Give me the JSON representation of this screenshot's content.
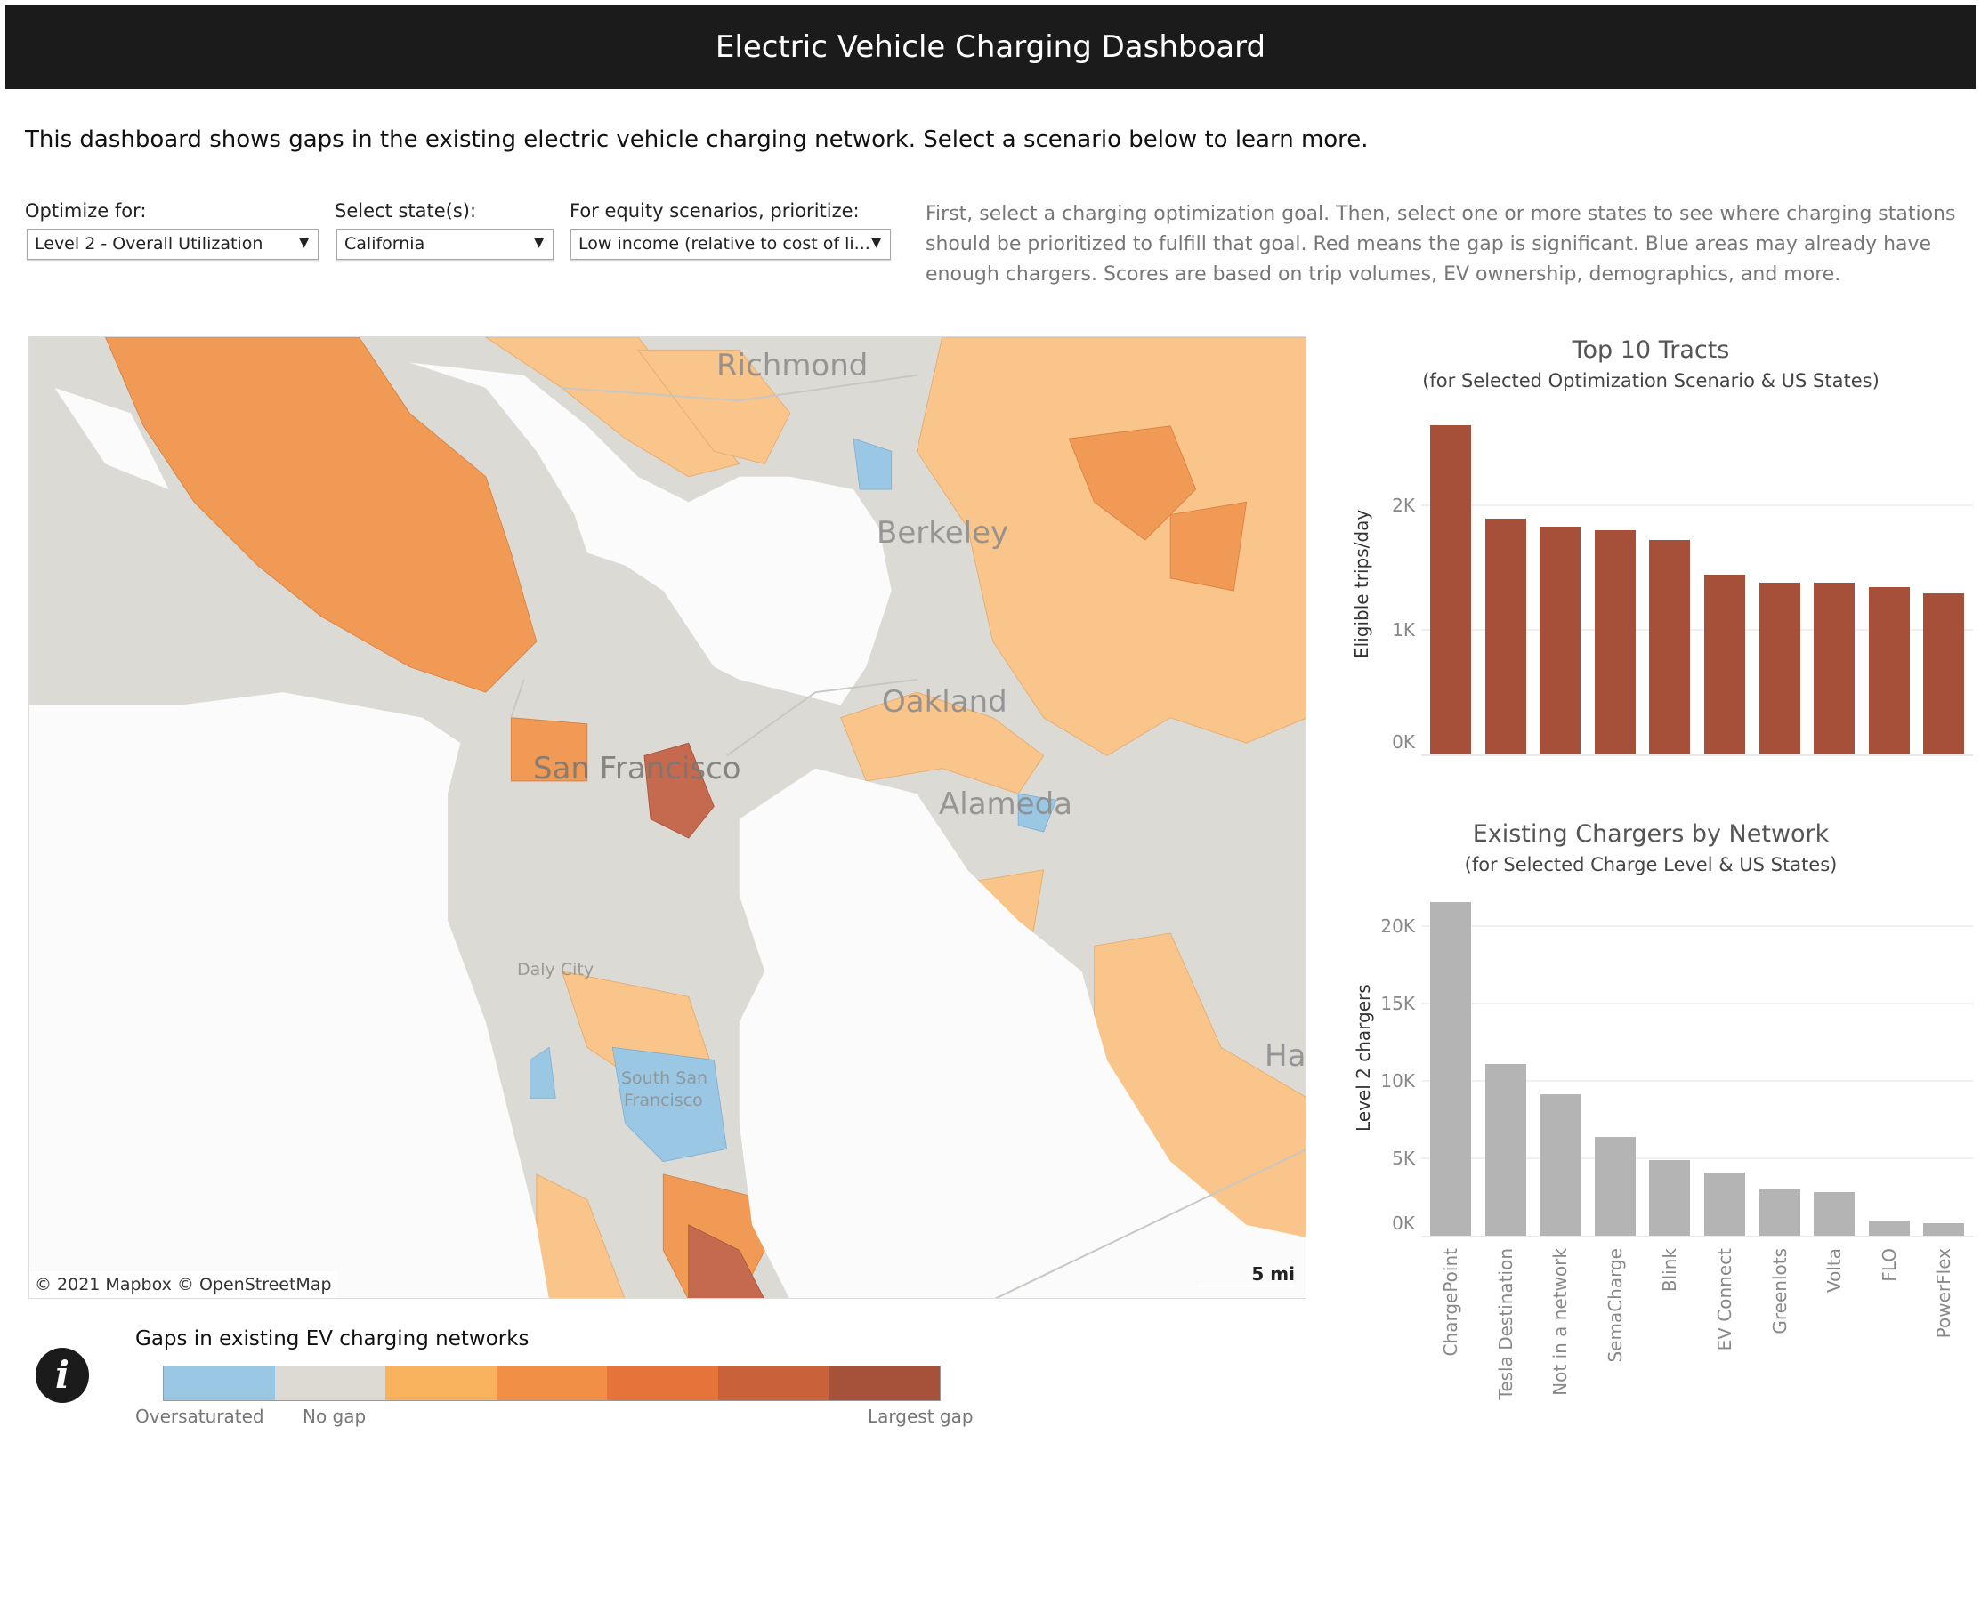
{
  "header": {
    "title": "Electric Vehicle Charging Dashboard"
  },
  "intro": "This dashboard shows gaps in the existing electric vehicle charging network. Select a scenario below to learn more.",
  "controls": [
    {
      "label": "Optimize for:",
      "value": "Level 2 - Overall Utilization"
    },
    {
      "label": "Select state(s):",
      "value": "California"
    },
    {
      "label": "For equity scenarios, prioritize:",
      "value": "Low income (relative to cost of li..."
    }
  ],
  "description": "First, select a charging optimization goal. Then, select one or more states to see where charging stations should be prioritized to fulfill that goal. Red means the gap is significant. Blue areas may already have enough chargers. Scores are based on trip volumes, EV ownership, demographics, and more.",
  "map": {
    "labels": {
      "richmond": "Richmond",
      "berkeley": "Berkeley",
      "oakland": "Oakland",
      "sf": "San Francisco",
      "alameda": "Alameda",
      "daly": "Daly City",
      "ssf1": "South San",
      "ssf2": "Francisco",
      "hayward": "Ha"
    },
    "attribution": "© 2021 Mapbox  © OpenStreetMap",
    "scale": "5 mi"
  },
  "legend": {
    "title": "Gaps in existing EV charging networks",
    "colors": [
      "#9ac8e4",
      "#dcdad3",
      "#f9b35f",
      "#f08f45",
      "#e5733a",
      "#c9623a",
      "#a6513a"
    ],
    "low": "Oversaturated",
    "mid": "No gap",
    "high": "Largest gap",
    "info_icon": "info-icon"
  },
  "chart_data": [
    {
      "type": "bar",
      "title": "Top 10 Tracts",
      "subtitle": "(for Selected Optimization Scenario & US States)",
      "ylabel": "Eligible trips/day",
      "yticks": [
        "0K",
        "1K",
        "2K"
      ],
      "ylim": [
        0,
        2700
      ],
      "color": "#a65039",
      "values": [
        2640,
        1890,
        1830,
        1800,
        1720,
        1440,
        1380,
        1380,
        1340,
        1290
      ]
    },
    {
      "type": "bar",
      "title": "Existing Chargers by Network",
      "subtitle": "(for Selected Charge Level & US States)",
      "ylabel": "Level 2 chargers",
      "yticks": [
        "0K",
        "5K",
        "10K",
        "15K",
        "20K"
      ],
      "ylim": [
        0,
        22000
      ],
      "color": "#b4b4b4",
      "categories": [
        "ChargePoint",
        "Tesla Destination",
        "Not in a network",
        "SemaCharge",
        "Blink",
        "EV Connect",
        "Greenlots",
        "Volta",
        "FLO",
        "PowerFlex"
      ],
      "values": [
        21500,
        11100,
        9100,
        6400,
        4900,
        4100,
        3000,
        2800,
        1000,
        800
      ]
    }
  ]
}
